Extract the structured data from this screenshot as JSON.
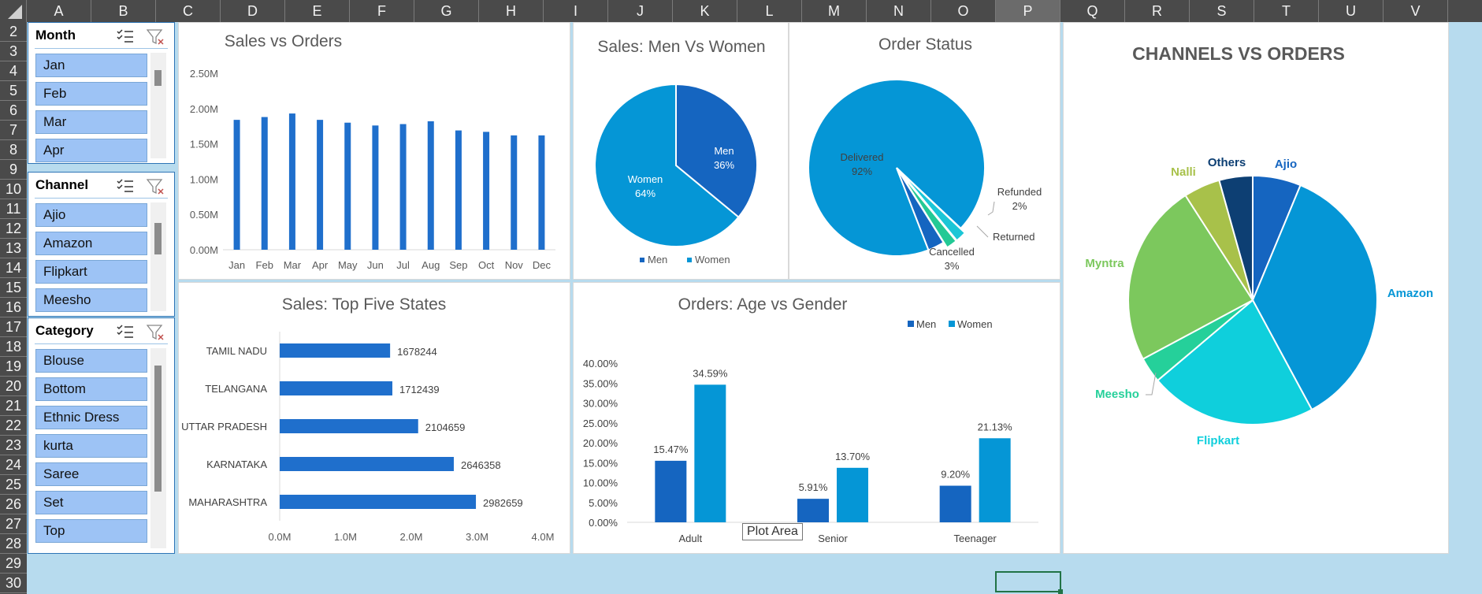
{
  "sheet": {
    "columns": [
      "A",
      "B",
      "C",
      "D",
      "E",
      "F",
      "G",
      "H",
      "I",
      "J",
      "K",
      "L",
      "M",
      "N",
      "O",
      "P",
      "Q",
      "R",
      "S",
      "T",
      "U",
      "V"
    ],
    "rows": [
      "2",
      "3",
      "4",
      "5",
      "6",
      "7",
      "8",
      "9",
      "10",
      "11",
      "12",
      "13",
      "14",
      "15",
      "16",
      "17",
      "18",
      "19",
      "20",
      "21",
      "22",
      "23",
      "24",
      "25",
      "26",
      "27",
      "28",
      "29",
      "30"
    ],
    "selected_column": "P"
  },
  "slicers": {
    "month": {
      "title": "Month",
      "items": [
        "Jan",
        "Feb",
        "Mar",
        "Apr"
      ]
    },
    "channel": {
      "title": "Channel",
      "items": [
        "Ajio",
        "Amazon",
        "Flipkart",
        "Meesho"
      ]
    },
    "category": {
      "title": "Category",
      "items": [
        "Blouse",
        "Bottom",
        "Ethnic Dress",
        "kurta",
        "Saree",
        "Set",
        "Top"
      ]
    }
  },
  "tooltip": {
    "text": "Plot Area"
  },
  "chart_data": [
    {
      "id": "sales-vs-orders",
      "type": "bar",
      "title": "Sales vs Orders",
      "categories": [
        "Jan",
        "Feb",
        "Mar",
        "Apr",
        "May",
        "Jun",
        "Jul",
        "Aug",
        "Sep",
        "Oct",
        "Nov",
        "Dec"
      ],
      "values": [
        1.84,
        1.88,
        1.93,
        1.84,
        1.8,
        1.76,
        1.78,
        1.82,
        1.69,
        1.67,
        1.62,
        1.62
      ],
      "unit": "M",
      "ylim": [
        0,
        2.5
      ],
      "yticks": [
        "0.00M",
        "0.50M",
        "1.00M",
        "1.50M",
        "2.00M",
        "2.50M"
      ],
      "color": "#1f6fcc"
    },
    {
      "id": "sales-men-women",
      "type": "pie",
      "title": "Sales: Men Vs Women",
      "labels": [
        "Men",
        "Women"
      ],
      "values": [
        36,
        64
      ],
      "display": [
        "36%",
        "64%"
      ],
      "colors": [
        "#1565c0",
        "#0596d6"
      ],
      "legend": "bottom"
    },
    {
      "id": "order-status",
      "type": "pie",
      "title": "Order Status",
      "labels": [
        "Delivered",
        "Refunded",
        "Returned",
        "Cancelled"
      ],
      "values": [
        92,
        2,
        2,
        3
      ],
      "display": [
        "92%",
        "2%",
        "",
        "3%"
      ],
      "colors": [
        "#0596d6",
        "#1bc6d6",
        "#23c995",
        "#1565c0"
      ]
    },
    {
      "id": "channels-vs-orders",
      "type": "pie",
      "title": "CHANNELS VS ORDERS",
      "labels": [
        "Ajio",
        "Amazon",
        "Flipkart",
        "Meesho",
        "Myntra",
        "Nalli",
        "Others"
      ],
      "values": [
        6.2,
        35.5,
        21.5,
        3.3,
        23.5,
        4.7,
        4.3
      ],
      "colors": [
        "#1565c0",
        "#0596d6",
        "#0fcfdc",
        "#25d09a",
        "#7cc85d",
        "#a8c14a",
        "#0d3f73"
      ]
    },
    {
      "id": "top-five-states",
      "type": "bar",
      "orientation": "horizontal",
      "title": "Sales: Top Five States",
      "categories": [
        "TAMIL NADU",
        "TELANGANA",
        "UTTAR PRADESH",
        "KARNATAKA",
        "MAHARASHTRA"
      ],
      "values": [
        1678244,
        1712439,
        2104659,
        2646358,
        2982659
      ],
      "xlim": [
        0,
        4000000
      ],
      "xticks": [
        "0.0M",
        "1.0M",
        "2.0M",
        "3.0M",
        "4.0M"
      ],
      "color": "#1f6fcc"
    },
    {
      "id": "age-vs-gender",
      "type": "bar",
      "title": "Orders: Age vs Gender",
      "categories": [
        "Adult",
        "Senior",
        "Teenager"
      ],
      "series": [
        {
          "name": "Men",
          "values": [
            15.47,
            5.91,
            9.2
          ],
          "labels": [
            "15.47%",
            "5.91%",
            "9.20%"
          ],
          "color": "#1565c0"
        },
        {
          "name": "Women",
          "values": [
            34.59,
            13.7,
            21.13
          ],
          "labels": [
            "34.59%",
            "13.70%",
            "21.13%"
          ],
          "color": "#0596d6"
        }
      ],
      "ylim": [
        0,
        40
      ],
      "yticks": [
        "0.00%",
        "5.00%",
        "10.00%",
        "15.00%",
        "20.00%",
        "25.00%",
        "30.00%",
        "35.00%",
        "40.00%"
      ],
      "legend": "top-right"
    }
  ]
}
